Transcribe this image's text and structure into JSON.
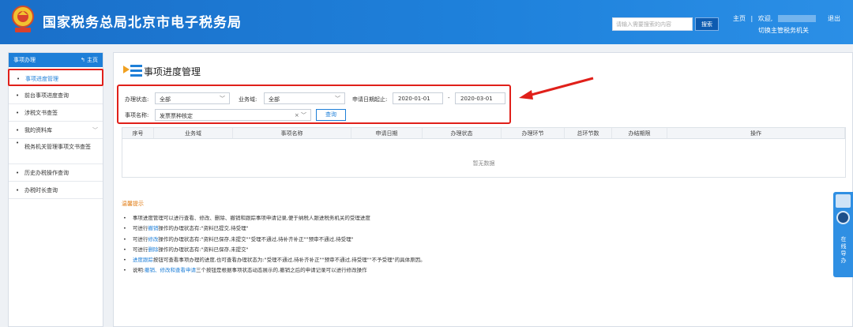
{
  "header": {
    "site_title": "国家税务总局北京市电子税务局",
    "search_placeholder": "请输入需要搜索的内容",
    "search_button": "搜索",
    "home_link": "主页",
    "welcome": "欢迎,",
    "switch_org": "切换主管税务机关",
    "logout": "退出"
  },
  "sidebar": {
    "title": "事项办理",
    "home": "主页",
    "items": [
      {
        "label": "事项进度管理"
      },
      {
        "label": "前台事项进度查询"
      },
      {
        "label": "涉税文书查签"
      },
      {
        "label": "我的资料库"
      },
      {
        "label": "税务机关管理事项文书查签"
      },
      {
        "label": "历史办税操作查询"
      },
      {
        "label": "办税时长查询"
      }
    ]
  },
  "main": {
    "title": "事项进度管理",
    "filters": {
      "status_label": "办理状态:",
      "status_value": "全部",
      "biz_label": "业务域:",
      "biz_value": "全部",
      "date_label": "申请日期起止:",
      "date_from": "2020-01-01",
      "date_sep": "-",
      "date_to": "2020-03-01",
      "item_label": "事项名称:",
      "item_value": "发票票种核定",
      "query_button": "查询"
    },
    "table": {
      "columns": [
        "序号",
        "业务域",
        "事项名称",
        "申请日期",
        "办理状态",
        "办理环节",
        "总环节数",
        "办结期限",
        "操作"
      ],
      "empty_text": "暂无数据"
    },
    "tips": {
      "title": "温馨提示",
      "lines": [
        [
          "",
          "事项进度管理可以进行查看、修改、删除、撤销和跟踪事项申请记录,便于纳税人跟进税务机关的受理进度",
          ""
        ],
        [
          "可进行",
          "撤销",
          "操作的办理状态有:\"资料已提交,待受理\""
        ],
        [
          "可进行",
          "修改",
          "操作的办理状态有:\"资料已保存,未提交\"\"受理不通过,待补齐补正\"\"预审不通过,待受理\""
        ],
        [
          "可进行",
          "删除",
          "操作的办理状态有:\"资料已保存,未提交\""
        ],
        [
          "",
          "进度跟踪",
          "按钮可查看事项办理的进度,也可查看办理状态为:\"受理不通过,待补齐补正\"\"预审不通过,待受理\"\"不予受理\"的具体原因。"
        ],
        [
          "说明:",
          "撤销、修改和查看申请",
          "三个按钮是根据事项状态动态展示的,撤销之后的申请记录可以进行修改操作"
        ]
      ]
    }
  },
  "guide": {
    "label": "在线导办"
  }
}
